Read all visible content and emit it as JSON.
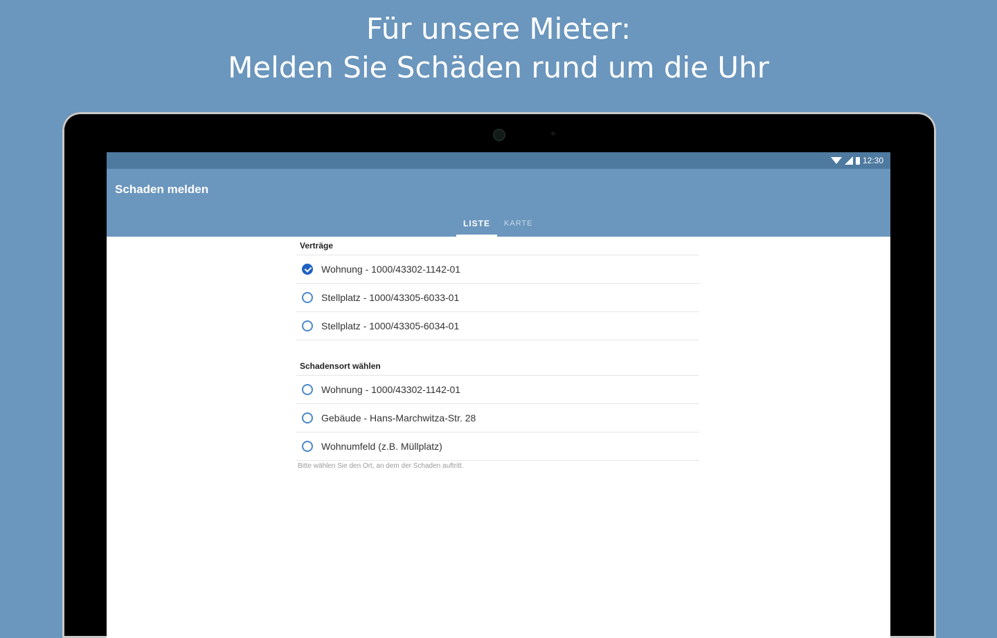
{
  "headline": {
    "line1": "Für unsere Mieter:",
    "line2": "Melden Sie Schäden rund um die Uhr"
  },
  "status_bar": {
    "time": "12:30",
    "icons": [
      "wifi-icon",
      "signal-icon",
      "battery-icon"
    ]
  },
  "app_bar": {
    "title": "Schaden melden"
  },
  "tabs": [
    {
      "label": "LISTE",
      "active": true
    },
    {
      "label": "KARTE",
      "active": false
    }
  ],
  "contracts": {
    "title": "Verträge",
    "items": [
      {
        "label": "Wohnung - 1000/43302-1142-01",
        "checked": true
      },
      {
        "label": "Stellplatz - 1000/43305-6033-01",
        "checked": false
      },
      {
        "label": "Stellplatz - 1000/43305-6034-01",
        "checked": false
      }
    ]
  },
  "location": {
    "title": "Schadensort wählen",
    "items": [
      {
        "label": "Wohnung - 1000/43302-1142-01",
        "checked": false
      },
      {
        "label": "Gebäude - Hans-Marchwitza-Str. 28",
        "checked": false
      },
      {
        "label": "Wohnumfeld (z.B. Müllplatz)",
        "checked": false
      }
    ],
    "helper": "Bitte wählen Sie den Ort, an dem der Schaden auftritt."
  },
  "colors": {
    "background": "#6b96bd",
    "status_bar": "#4f7aa0",
    "accent": "#1f63c2"
  }
}
